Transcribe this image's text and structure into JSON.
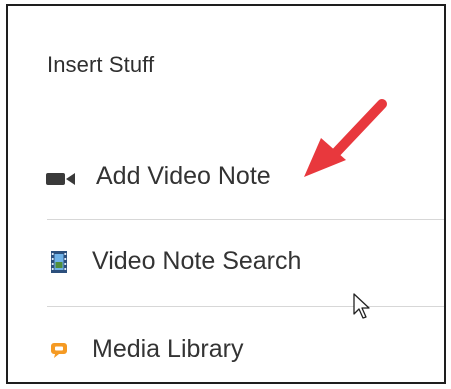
{
  "panel": {
    "title": "Insert Stuff",
    "items": [
      {
        "label": "Add Video Note",
        "icon": "video-camera-icon"
      },
      {
        "label": "Video Note Search",
        "icon": "film-strip-icon"
      },
      {
        "label": "Media Library",
        "icon": "media-library-icon"
      }
    ]
  },
  "colors": {
    "annotation_arrow": "#e8383d",
    "text": "#333333",
    "divider": "#d7d7d7",
    "film_icon_blue": "#3c7fc4",
    "media_icon_orange": "#f59a23"
  }
}
